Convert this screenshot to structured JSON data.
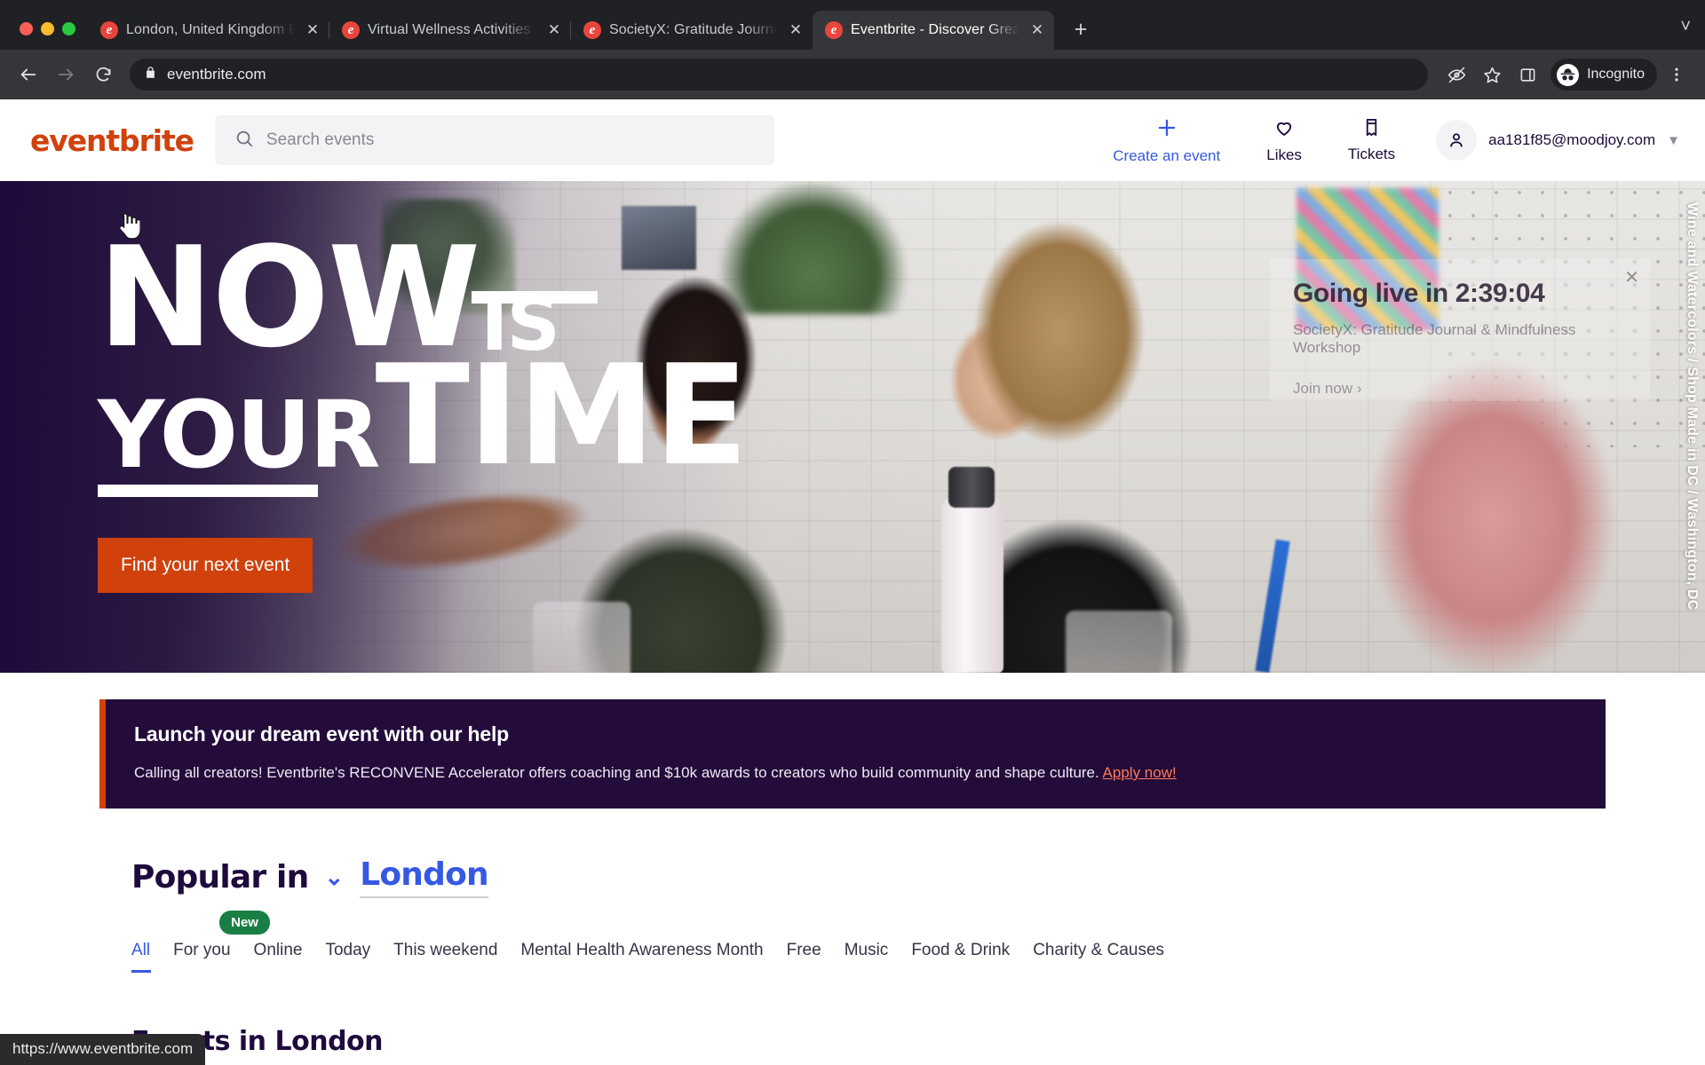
{
  "browser": {
    "tabs": [
      {
        "title": "London, United Kingdom Events",
        "active": false
      },
      {
        "title": "Virtual Wellness Activities | Eve",
        "active": false
      },
      {
        "title": "SocietyX: Gratitude Journal & M",
        "active": false
      },
      {
        "title": "Eventbrite - Discover Great Eve",
        "active": true
      }
    ],
    "new_tab_label": "+",
    "tabstrip_menu_icon": "chevron-down-icon",
    "back_icon": "back-arrow-icon",
    "forward_icon": "forward-arrow-icon",
    "reload_icon": "reload-icon",
    "lock_icon": "lock-icon",
    "url": "eventbrite.com",
    "toolbar_icons": [
      "eye-slash-icon",
      "star-icon",
      "side-panel-icon"
    ],
    "profile_label": "Incognito",
    "menu_icon": "kebab-menu-icon",
    "status_bar_url": "https://www.eventbrite.com"
  },
  "site_header": {
    "logo_text": "eventbrite",
    "search_placeholder": "Search events",
    "search_value": "",
    "search_icon": "search-icon",
    "nav": [
      {
        "label": "Create an event",
        "icon": "plus-icon"
      },
      {
        "label": "Likes",
        "icon": "heart-icon"
      },
      {
        "label": "Tickets",
        "icon": "ticket-icon"
      }
    ],
    "account_email": "aa181f85@moodjoy.com",
    "account_icon": "person-icon",
    "account_chevron": "chevron-down-icon"
  },
  "hero": {
    "headline_word1": "NOW",
    "headline_word2": "IS",
    "headline_word3": "YOUR",
    "headline_word4": "TIME",
    "cta_label": "Find your next event",
    "live_card": {
      "countdown": "Going live in 2:39:04",
      "event_name": "SocietyX: Gratitude Journal & Mindfulness Workshop",
      "join_label": "Join now  ›",
      "close_icon": "close-icon"
    },
    "photo_caption": "Wine and Watercolors / Shop Made in DC / Washington, DC",
    "colors": {
      "accent": "#d1410c",
      "scrim": "#1e0a3c"
    }
  },
  "promo": {
    "heading": "Launch your dream event with our help",
    "body": "Calling all creators! Eventbrite's RECONVENE Accelerator offers coaching and $10k awards to creators who build community and shape culture.",
    "link_label": "Apply now!",
    "accent": "#d1410c",
    "background": "#230b3a"
  },
  "popular": {
    "title": "Popular in",
    "city": "London",
    "city_chevron": "chevron-down-icon",
    "categories": [
      {
        "label": "All",
        "active": true
      },
      {
        "label": "For you",
        "active": false,
        "badge": "New"
      },
      {
        "label": "Online",
        "active": false
      },
      {
        "label": "Today",
        "active": false
      },
      {
        "label": "This weekend",
        "active": false
      },
      {
        "label": "Mental Health Awareness Month",
        "active": false
      },
      {
        "label": "Free",
        "active": false
      },
      {
        "label": "Music",
        "active": false
      },
      {
        "label": "Food & Drink",
        "active": false
      },
      {
        "label": "Charity & Causes",
        "active": false
      }
    ],
    "section_title": "Events in London"
  }
}
